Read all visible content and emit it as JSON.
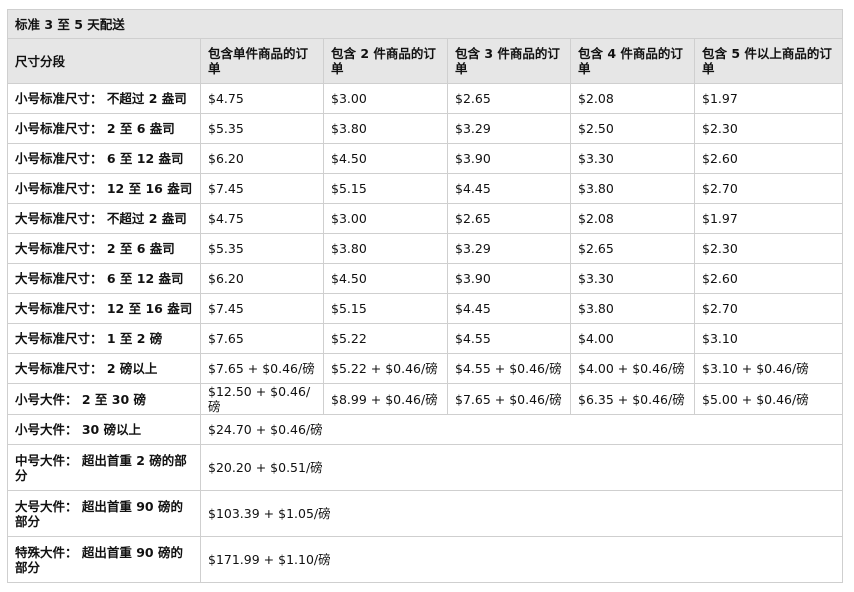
{
  "caption": "标准 3 至 5 天配送",
  "headers": [
    "尺寸分段",
    "包含单件商品的订单",
    "包含 2 件商品的订单",
    "包含 3 件商品的订单",
    "包含 4 件商品的订单",
    "包含 5 件以上商品的订单"
  ],
  "rows": [
    {
      "label": "小号标准尺寸： 不超过 2 盎司",
      "cells": [
        "$4.75",
        "$3.00",
        "$2.65",
        "$2.08",
        "$1.97"
      ]
    },
    {
      "label": "小号标准尺寸： 2 至 6 盎司",
      "cells": [
        "$5.35",
        "$3.80",
        "$3.29",
        "$2.50",
        "$2.30"
      ]
    },
    {
      "label": "小号标准尺寸： 6 至 12 盎司",
      "cells": [
        "$6.20",
        "$4.50",
        "$3.90",
        "$3.30",
        "$2.60"
      ]
    },
    {
      "label": "小号标准尺寸： 12 至 16 盎司",
      "cells": [
        "$7.45",
        "$5.15",
        "$4.45",
        "$3.80",
        "$2.70"
      ]
    },
    {
      "label": "大号标准尺寸： 不超过 2 盎司",
      "cells": [
        "$4.75",
        "$3.00",
        "$2.65",
        "$2.08",
        "$1.97"
      ]
    },
    {
      "label": "大号标准尺寸： 2 至 6 盎司",
      "cells": [
        "$5.35",
        "$3.80",
        "$3.29",
        "$2.65",
        "$2.30"
      ]
    },
    {
      "label": "大号标准尺寸： 6 至 12 盎司",
      "cells": [
        "$6.20",
        "$4.50",
        "$3.90",
        "$3.30",
        "$2.60"
      ]
    },
    {
      "label": "大号标准尺寸： 12 至 16 盎司",
      "cells": [
        "$7.45",
        "$5.15",
        "$4.45",
        "$3.80",
        "$2.70"
      ]
    },
    {
      "label": "大号标准尺寸： 1 至 2 磅",
      "cells": [
        "$7.65",
        "$5.22",
        "$4.55",
        "$4.00",
        "$3.10"
      ]
    },
    {
      "label": "大号标准尺寸： 2 磅以上",
      "cells": [
        "$7.65 + $0.46/磅",
        "$5.22 + $0.46/磅",
        "$4.55 + $0.46/磅",
        "$4.00 + $0.46/磅",
        "$3.10 + $0.46/磅"
      ]
    },
    {
      "label": "小号大件： 2 至 30 磅",
      "cells": [
        "$12.50 + $0.46/磅",
        "$8.99 + $0.46/磅",
        "$7.65 + $0.46/磅",
        "$6.35 + $0.46/磅",
        "$5.00 + $0.46/磅"
      ]
    }
  ],
  "span_rows": [
    {
      "label": "小号大件： 30 磅以上",
      "value": "$24.70 + $0.46/磅"
    },
    {
      "label": "中号大件： 超出首重 2 磅的部分",
      "value": "$20.20 + $0.51/磅"
    },
    {
      "label": "大号大件： 超出首重 90 磅的部分",
      "value": "$103.39 + $1.05/磅"
    },
    {
      "label": "特殊大件： 超出首重 90 磅的部分",
      "value": "$171.99 + $1.10/磅"
    }
  ]
}
